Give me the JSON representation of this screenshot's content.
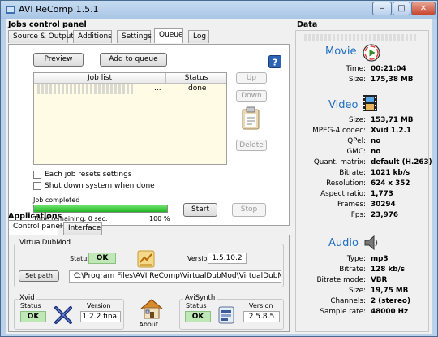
{
  "window": {
    "title": "AVI ReComp  1.5.1",
    "minimize": "–",
    "maximize": "□",
    "close": "✕"
  },
  "jobs": {
    "header": "Jobs control panel",
    "tabs": [
      "Source & Output",
      "Additions",
      "Settings",
      "Queue",
      "Log"
    ],
    "active_tab": "Queue",
    "preview_button": "Preview",
    "add_queue_button": "Add to queue",
    "list_headers": [
      "Job list",
      "Status"
    ],
    "rows": [
      {
        "job": "...",
        "status": "done"
      }
    ],
    "up_button": "Up",
    "down_button": "Down",
    "delete_button": "Delete",
    "each_job_resets": "Each job resets settings",
    "shutdown": "Shut down system when done",
    "job_completed": "Job completed",
    "progress": 1.0,
    "progress_label": "100 %",
    "time_remaining": "Time remaining: 0 sec.",
    "start_button": "Start",
    "stop_button": "Stop"
  },
  "applications": {
    "header": "Applications",
    "tabs": [
      "Control panel",
      "Interface"
    ],
    "active_tab": "Control panel",
    "virtualdub": {
      "group": "VirtualDubMod",
      "status_label": "Status",
      "status": "OK",
      "version_label": "Version",
      "version": "1.5.10.2",
      "set_path_button": "Set path",
      "path": "C:\\Program Files\\AVI ReComp\\VirtualDubMod\\VirtualDubMod.exe"
    },
    "xvid": {
      "group": "Xvid",
      "status_label": "Status",
      "status": "OK",
      "version_label": "Version",
      "version": "1.2.2 final"
    },
    "about_button": "About...",
    "avisynth": {
      "group": "AviSynth",
      "status_label": "Status",
      "status": "OK",
      "version_label": "Version",
      "version": "2.5.8.5"
    }
  },
  "data": {
    "header": "Data",
    "movie": {
      "title": "Movie",
      "rows": [
        {
          "label": "Time:",
          "value": "00:21:04"
        },
        {
          "label": "Size:",
          "value": "175,38 MB"
        }
      ]
    },
    "video": {
      "title": "Video",
      "rows": [
        {
          "label": "Size:",
          "value": "153,71 MB"
        },
        {
          "label": "MPEG-4 codec:",
          "value": "Xvid 1.2.1"
        },
        {
          "label": "QPel:",
          "value": "no"
        },
        {
          "label": "GMC:",
          "value": "no"
        },
        {
          "label": "Quant. matrix:",
          "value": "default (H.263)"
        },
        {
          "label": "Bitrate:",
          "value": "1021 kb/s"
        },
        {
          "label": "Resolution:",
          "value": "624 x 352"
        },
        {
          "label": "Aspect ratio:",
          "value": "1,773"
        },
        {
          "label": "Frames:",
          "value": "30294"
        },
        {
          "label": "Fps:",
          "value": "23,976"
        }
      ]
    },
    "audio": {
      "title": "Audio",
      "rows": [
        {
          "label": "Type:",
          "value": "mp3"
        },
        {
          "label": "Bitrate:",
          "value": "128 kb/s"
        },
        {
          "label": "Bitrate mode:",
          "value": "VBR"
        },
        {
          "label": "Size:",
          "value": "19,75 MB"
        },
        {
          "label": "Channels:",
          "value": "2 (stereo)"
        },
        {
          "label": "Sample rate:",
          "value": "48000 Hz"
        }
      ]
    }
  },
  "colors": {
    "accent": "#1e6fc4",
    "progress": "#22c322",
    "ok_bg": "#bfe8b6"
  }
}
